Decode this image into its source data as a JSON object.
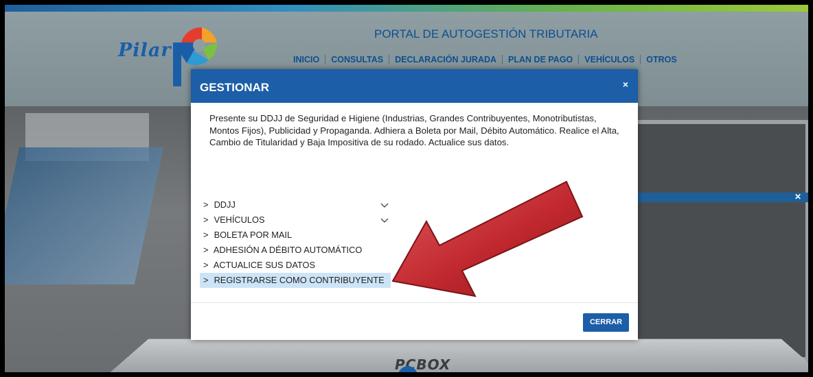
{
  "header": {
    "logo_text": "Pilar",
    "portal_title": "PORTAL DE AUTOGESTIÓN TRIBUTARIA",
    "nav": [
      "INICIO",
      "CONSULTAS",
      "DECLARACIÓN JURADA",
      "PLAN DE PAGO",
      "VEHÍCULOS",
      "OTROS"
    ]
  },
  "background": {
    "brand_text": "PCBOX"
  },
  "modal": {
    "title": "GESTIONAR",
    "close_icon": "×",
    "description": "Presente su DDJJ de Seguridad e Higiene (Industrias, Grandes Contribuyentes, Monotributistas, Montos Fijos), Publicidad y Propaganda. Adhiera a Boleta por Mail, Débito Automático. Realice el Alta, Cambio de Titularidad y Baja Impositiva de su rodado. Actualice sus datos.",
    "items": [
      {
        "label": "DDJJ",
        "expandable": true
      },
      {
        "label": "VEHÍCULOS",
        "expandable": true
      },
      {
        "label": "BOLETA POR MAIL",
        "expandable": false
      },
      {
        "label": "ADHESIÓN A DÉBITO AUTOMÁTICO",
        "expandable": false
      },
      {
        "label": "ACTUALICE SUS DATOS",
        "expandable": false
      },
      {
        "label": "REGISTRARSE COMO CONTRIBUYENTE",
        "expandable": false,
        "highlighted": true
      }
    ],
    "close_button": "CERRAR"
  },
  "colors": {
    "brand_blue": "#1c5ea7",
    "highlight": "#cde4f7",
    "arrow_red": "#c0282e"
  }
}
